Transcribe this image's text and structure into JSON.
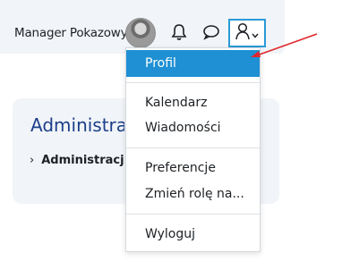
{
  "topbar": {
    "username": "Manager Pokazowy",
    "icons": {
      "notifications": "bell-icon",
      "messages": "chat-icon",
      "user": "user-icon",
      "chevron": "chevron-down-icon"
    }
  },
  "card": {
    "title": "Administracja",
    "subitem": "Administracja strony"
  },
  "user_menu": {
    "items": [
      {
        "label": "Profil",
        "active": true
      },
      {
        "label": "Kalendarz"
      },
      {
        "label": "Wiadomości"
      },
      {
        "label": "Preferencje"
      },
      {
        "label": "Zmień rolę na..."
      },
      {
        "label": "Wyloguj"
      }
    ]
  },
  "colors": {
    "accent": "#1e90d3",
    "annotation_arrow": "#e0272b",
    "title": "#1c3f8a"
  }
}
